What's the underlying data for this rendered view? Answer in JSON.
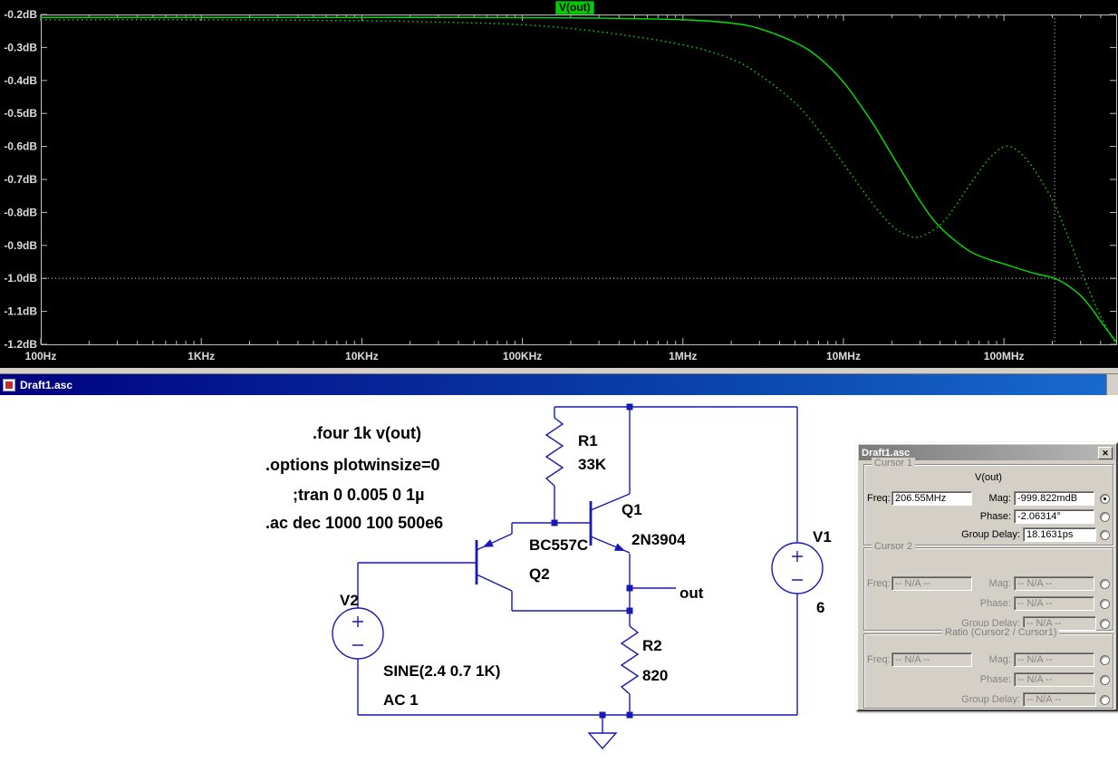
{
  "plot": {
    "trace_label": "V(out)"
  },
  "titlebar": {
    "title": "Draft1.asc"
  },
  "chart_data": {
    "type": "line",
    "title": "V(out)",
    "background": "#000000",
    "frame_color": "#bebebe",
    "label_color": "#dcdcdc",
    "legend_position": "top-center",
    "grid": false,
    "x_axis": {
      "scale": "log",
      "min": 100,
      "max": 500000000,
      "ticks": [
        {
          "value": 100,
          "label": "100Hz"
        },
        {
          "value": 1000,
          "label": "1KHz"
        },
        {
          "value": 10000,
          "label": "10KHz"
        },
        {
          "value": 100000,
          "label": "100KHz"
        },
        {
          "value": 1000000,
          "label": "1MHz"
        },
        {
          "value": 10000000,
          "label": "10MHz"
        },
        {
          "value": 100000000,
          "label": "100MHz"
        }
      ]
    },
    "y_axis": {
      "unit": "dB",
      "min": -1.2,
      "max": -0.2,
      "ticks": [
        {
          "value": -0.2,
          "label": "-0.2dB"
        },
        {
          "value": -0.3,
          "label": "-0.3dB"
        },
        {
          "value": -0.4,
          "label": "-0.4dB"
        },
        {
          "value": -0.5,
          "label": "-0.5dB"
        },
        {
          "value": -0.6,
          "label": "-0.6dB"
        },
        {
          "value": -0.7,
          "label": "-0.7dB"
        },
        {
          "value": -0.8,
          "label": "-0.8dB"
        },
        {
          "value": -0.9,
          "label": "-0.9dB"
        },
        {
          "value": -1.0,
          "label": "-1.0dB"
        },
        {
          "value": -1.1,
          "label": "-1.1dB"
        },
        {
          "value": -1.2,
          "label": "-1.2dB"
        }
      ]
    },
    "cursor1": {
      "freq_hz": 206550000,
      "db": -0.999822
    },
    "series": [
      {
        "name": "V(out) solid",
        "style": "solid",
        "color": "#00e500",
        "points": [
          [
            100,
            -0.209
          ],
          [
            1000,
            -0.209
          ],
          [
            10000,
            -0.209
          ],
          [
            30000,
            -0.209
          ],
          [
            100000,
            -0.21
          ],
          [
            300000,
            -0.211
          ],
          [
            1000000,
            -0.216
          ],
          [
            2000000,
            -0.226
          ],
          [
            3000000,
            -0.243
          ],
          [
            5000000,
            -0.285
          ],
          [
            7000000,
            -0.33
          ],
          [
            10000000,
            -0.405
          ],
          [
            15000000,
            -0.525
          ],
          [
            20000000,
            -0.625
          ],
          [
            30000000,
            -0.765
          ],
          [
            40000000,
            -0.845
          ],
          [
            60000000,
            -0.915
          ],
          [
            80000000,
            -0.942
          ],
          [
            100000000,
            -0.956
          ],
          [
            150000000,
            -0.983
          ],
          [
            206550000,
            -0.9998
          ],
          [
            250000000,
            -1.022
          ],
          [
            300000000,
            -1.052
          ],
          [
            350000000,
            -1.09
          ],
          [
            400000000,
            -1.13
          ],
          [
            450000000,
            -1.163
          ],
          [
            500000000,
            -1.192
          ]
        ]
      },
      {
        "name": "V(out) dotted",
        "style": "dotted",
        "color": "#00e500",
        "points": [
          [
            100,
            -0.216
          ],
          [
            1000,
            -0.216
          ],
          [
            10000,
            -0.219
          ],
          [
            30000,
            -0.223
          ],
          [
            100000,
            -0.231
          ],
          [
            300000,
            -0.252
          ],
          [
            1000000,
            -0.292
          ],
          [
            2000000,
            -0.335
          ],
          [
            3000000,
            -0.383
          ],
          [
            5000000,
            -0.468
          ],
          [
            7000000,
            -0.55
          ],
          [
            10000000,
            -0.652
          ],
          [
            15000000,
            -0.77
          ],
          [
            20000000,
            -0.84
          ],
          [
            25000000,
            -0.869
          ],
          [
            30000000,
            -0.874
          ],
          [
            40000000,
            -0.838
          ],
          [
            50000000,
            -0.78
          ],
          [
            60000000,
            -0.722
          ],
          [
            80000000,
            -0.64
          ],
          [
            100000000,
            -0.601
          ],
          [
            120000000,
            -0.611
          ],
          [
            150000000,
            -0.662
          ],
          [
            200000000,
            -0.762
          ],
          [
            250000000,
            -0.872
          ],
          [
            300000000,
            -0.972
          ],
          [
            350000000,
            -1.052
          ],
          [
            400000000,
            -1.115
          ],
          [
            450000000,
            -1.162
          ],
          [
            500000000,
            -1.2
          ]
        ]
      }
    ]
  },
  "schematic": {
    "directives": [
      ".four 1k v(out)",
      ".options plotwinsize=0",
      ";tran 0 0.005 0 1µ",
      ".ac dec 1000 100 500e6"
    ],
    "r1_name": "R1",
    "r1_value": "33K",
    "r2_name": "R2",
    "r2_value": "820",
    "q1_name": "Q1",
    "q1_type": "2N3904",
    "q2_name": "Q2",
    "q2_type": "BC557C",
    "v1_name": "V1",
    "v1_value": "6",
    "v2_name": "V2",
    "v2_value": "SINE(2.4 0.7 1K)",
    "v2_value2": "AC 1",
    "net_out": "out"
  },
  "cursor_dialog": {
    "title": "Draft1.asc",
    "cursor1": {
      "legend": "Cursor 1",
      "trace": "V(out)",
      "freq_label": "Freq:",
      "freq": "206.55MHz",
      "mag_label": "Mag:",
      "mag": "-999.822mdB",
      "phase_label": "Phase:",
      "phase": "-2.06314°",
      "group_delay_label": "Group Delay:",
      "group_delay": "18.1631ps"
    },
    "cursor2": {
      "legend": "Cursor 2",
      "freq_label": "Freq:",
      "freq": "-- N/A --",
      "mag_label": "Mag:",
      "mag": "-- N/A --",
      "phase_label": "Phase:",
      "phase": "-- N/A --",
      "group_delay_label": "Group Delay:",
      "group_delay": "-- N/A --"
    },
    "ratio": {
      "legend": "Ratio (Cursor2 / Cursor1)",
      "freq_label": "Freq:",
      "freq": "-- N/A --",
      "mag_label": "Mag:",
      "mag": "-- N/A --",
      "phase_label": "Phase:",
      "phase": "-- N/A --",
      "group_delay_label": "Group Delay:",
      "group_delay": "-- N/A --"
    }
  }
}
